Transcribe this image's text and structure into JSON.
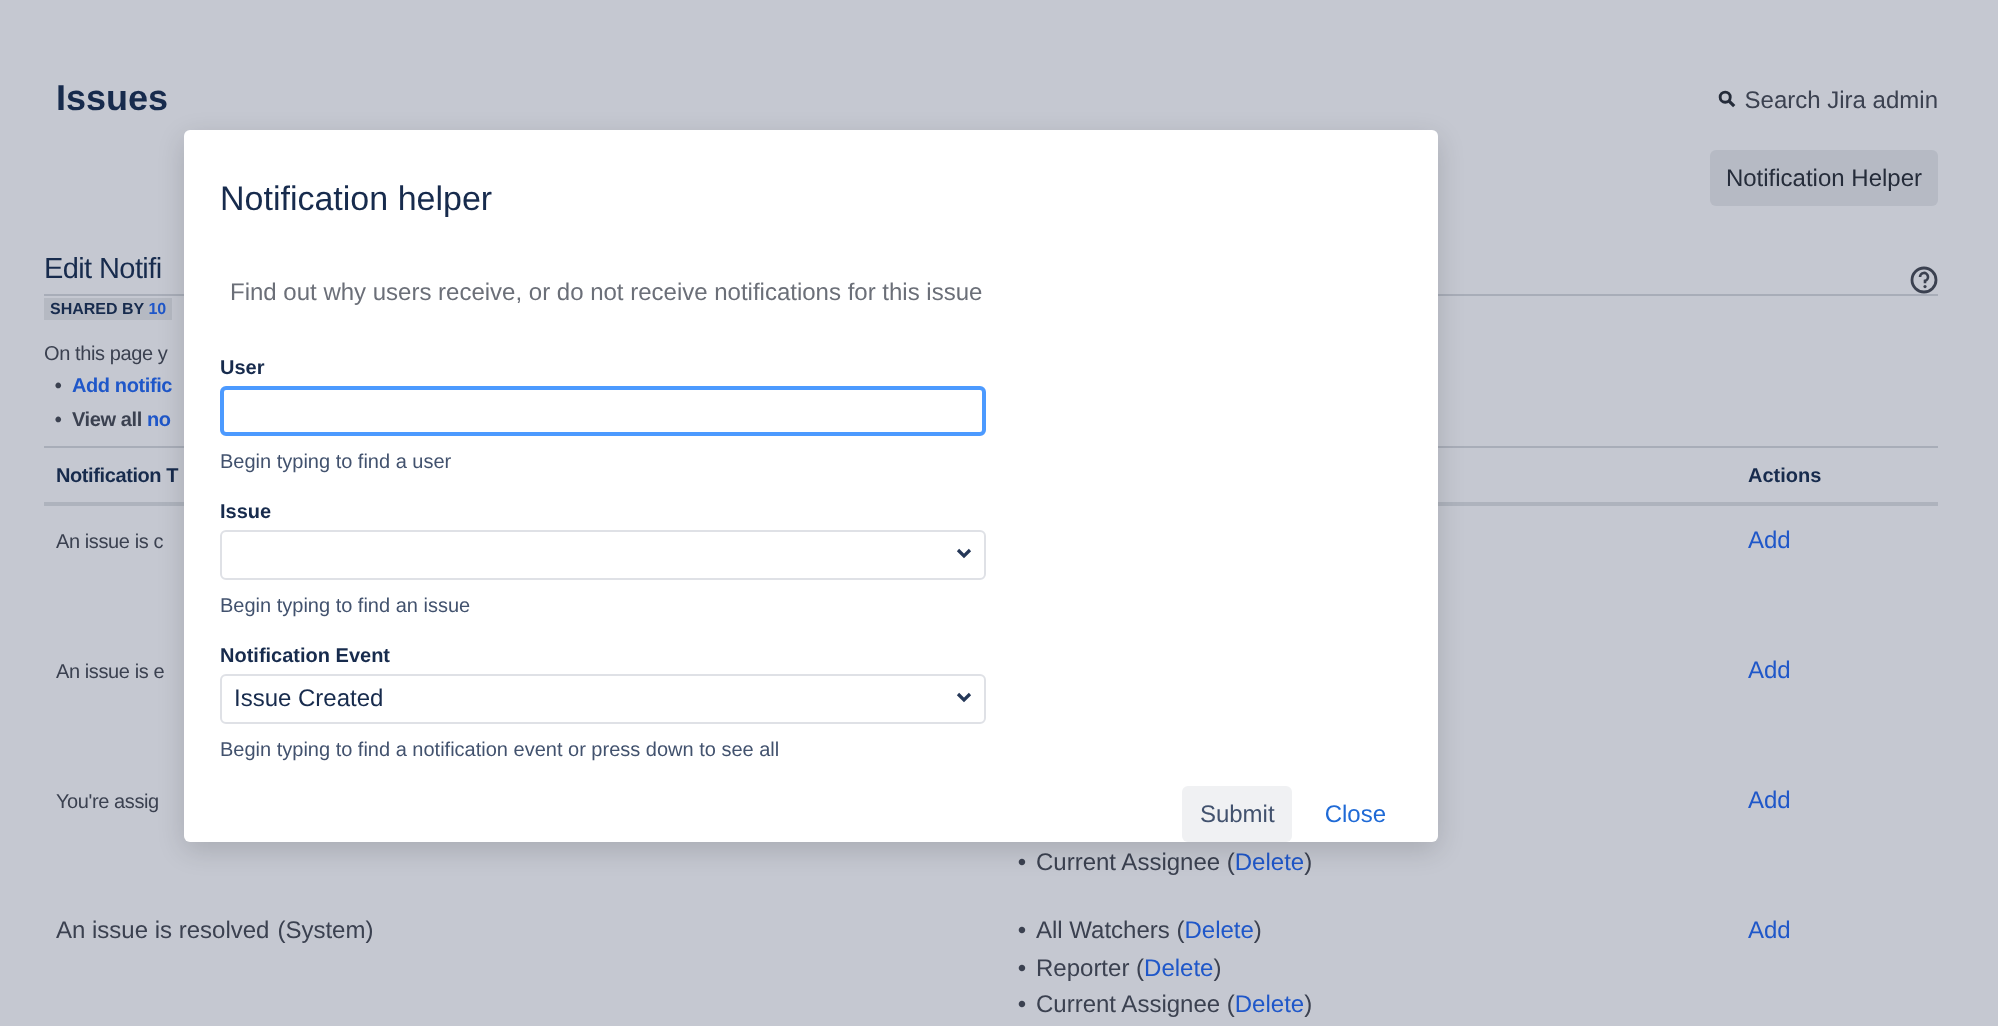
{
  "page": {
    "title": "Issues",
    "search_link": "Search Jira admin",
    "helper_button": "Notification Helper",
    "section_title": "Edit Notifi",
    "shared_by": "SHARED BY",
    "shared_by_link": "10",
    "intro": "On this page y",
    "bullets": [
      {
        "marker": "•",
        "link": "Add notific"
      },
      {
        "marker": "•",
        "bold": "View all",
        "link": "no"
      }
    ],
    "table": {
      "columns": [
        "Notification T",
        "Actions"
      ],
      "rows": [
        {
          "event": "An issue is c",
          "recipients": [],
          "action": "Add"
        },
        {
          "event": "An issue is e",
          "recipients": [],
          "action": "Add"
        },
        {
          "event": "You're assig",
          "recipients": [
            {
              "marker": "•",
              "name": "Current Assignee (",
              "link": "Delete",
              "close": ")"
            }
          ],
          "action": "Add"
        },
        {
          "event": "An issue is resolved",
          "event_suffix": "(System)",
          "recipients": [
            {
              "marker": "•",
              "name": "All Watchers (",
              "link": "Delete",
              "close": ")"
            },
            {
              "marker": "•",
              "name": "Reporter (",
              "link": "Delete",
              "close": ")"
            },
            {
              "marker": "•",
              "name": "Current Assignee (",
              "link": "Delete",
              "close": ")"
            }
          ],
          "action": "Add"
        }
      ]
    }
  },
  "dialog": {
    "title": "Notification helper",
    "description": "Find out why users receive, or do not receive notifications for this issue",
    "fields": [
      {
        "kind": "text",
        "label": "User",
        "focused": true,
        "help": "Begin typing to find a user"
      },
      {
        "kind": "select",
        "label": "Issue",
        "focused": false,
        "help": "Begin typing to find an issue"
      },
      {
        "kind": "select",
        "label": "Notification Event",
        "value": "Issue Created",
        "focused": false,
        "help": "Begin typing to find a notification event or press down to see all"
      }
    ],
    "submit": "Submit",
    "close": "Close"
  }
}
